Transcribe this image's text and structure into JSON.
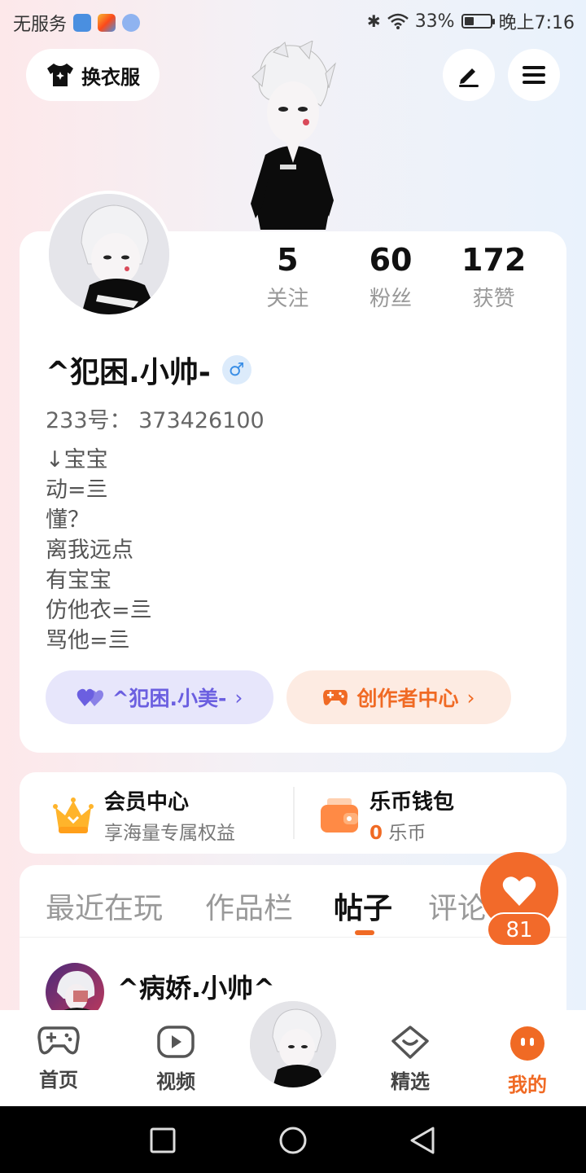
{
  "status_bar": {
    "carrier": "无服务",
    "battery": "33%",
    "battery_level": 0.33,
    "time": "晚上7:16"
  },
  "header": {
    "dress_button_label": "换衣服"
  },
  "profile": {
    "stats": [
      {
        "value": "5",
        "label": "关注"
      },
      {
        "value": "60",
        "label": "粉丝"
      },
      {
        "value": "172",
        "label": "获赞"
      }
    ],
    "username": "^犯困.小帅-",
    "gender_symbol": "♂",
    "uid": "233号：  373426100",
    "bio_lines": [
      "↓宝宝",
      "动=亖",
      "懂？",
      "离我远点",
      "有宝宝",
      "仿他衣=亖",
      "骂他=亖"
    ],
    "partner_label": "^犯困.小美-",
    "creator_label": "创作者中心"
  },
  "member": {
    "title": "会员中心",
    "subtitle": "享海量专属权益"
  },
  "wallet": {
    "title": "乐币钱包",
    "amount": "0",
    "unit": "乐币"
  },
  "tabs": [
    {
      "label": "最近在玩"
    },
    {
      "label": "作品栏"
    },
    {
      "label": "帖子"
    },
    {
      "label": "评论"
    }
  ],
  "post": {
    "author": "^病娇.小帅^"
  },
  "like_fab": {
    "count": "81"
  },
  "bottom_nav": [
    {
      "label": "首页"
    },
    {
      "label": "视频"
    },
    {
      "label": "精选"
    },
    {
      "label": "我的"
    }
  ],
  "colors": {
    "accent": "#f06a24",
    "partner": "#6b5fe0"
  }
}
